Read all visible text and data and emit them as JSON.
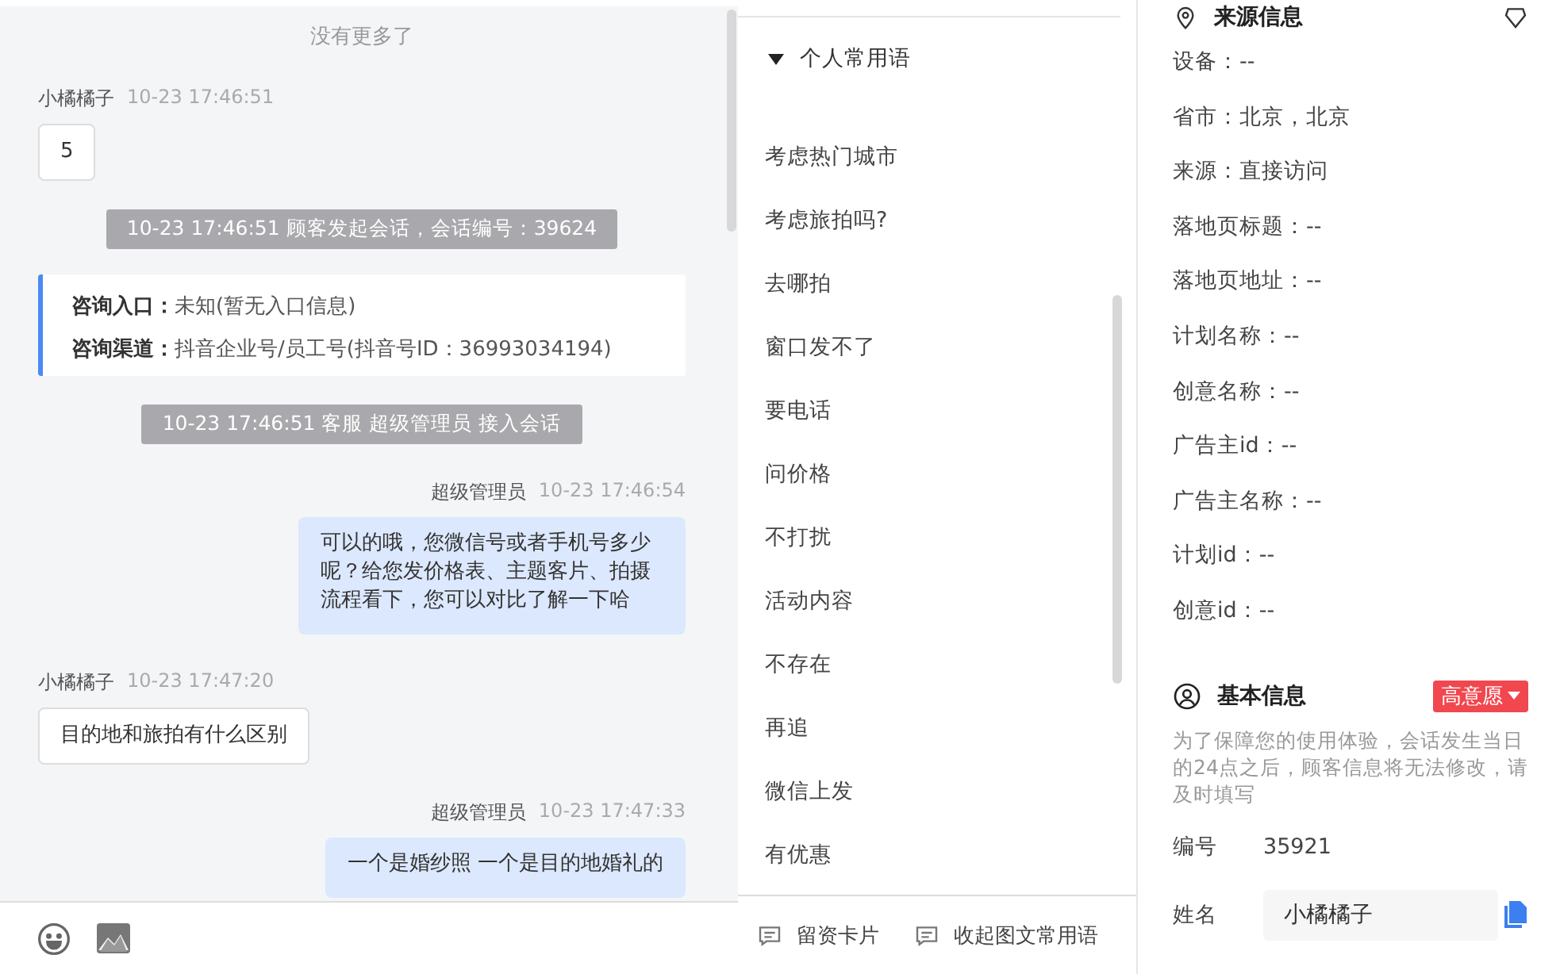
{
  "chat": {
    "messages": [
      {
        "kind": "notice",
        "text": "没有更多了"
      },
      {
        "kind": "message",
        "from_agent": false,
        "sender": "小橘橘子",
        "time": "10-23 17:46:51",
        "text": "5"
      },
      {
        "kind": "system",
        "text": "10-23 17:46:51 顾客发起会话，会话编号：39624"
      },
      {
        "kind": "info",
        "rows": [
          {
            "label": "咨询入口：",
            "value": "未知(暂无入口信息)"
          },
          {
            "label": "咨询渠道：",
            "value": "抖音企业号/员工号(抖音号ID：36993034194)"
          }
        ]
      },
      {
        "kind": "system",
        "text": "10-23 17:46:51 客服 超级管理员 接入会话"
      },
      {
        "kind": "message",
        "from_agent": true,
        "sender": "超级管理员",
        "time": "10-23 17:46:54",
        "text": "可以的哦，您微信号或者手机号多少呢？给您发价格表、主题客片、拍摄流程看下，您可以对比了解一下哈"
      },
      {
        "kind": "message",
        "from_agent": false,
        "sender": "小橘橘子",
        "time": "10-23 17:47:20",
        "text": "目的地和旅拍有什么区别"
      },
      {
        "kind": "message",
        "from_agent": true,
        "sender": "超级管理员",
        "time": "10-23 17:47:33",
        "text": "一个是婚纱照 一个是目的地婚礼的"
      }
    ]
  },
  "phrases": {
    "group": {
      "title": "个人常用语",
      "expanded": true
    },
    "items": [
      "考虑热门城市",
      "考虑旅拍吗?",
      "去哪拍",
      "窗口发不了",
      "要电话",
      "问价格",
      "不打扰",
      "活动内容",
      "不存在",
      "再追",
      "微信上发",
      "有优惠"
    ],
    "footer": [
      "留资卡片",
      "收起图文常用语"
    ]
  },
  "source_info": {
    "title": "来源信息",
    "fields": [
      "设备：--",
      "省市：北京，北京",
      "来源：直接访问",
      "落地页标题：--",
      "落地页地址：--",
      "计划名称：--",
      "创意名称：--",
      "广告主id：--",
      "广告主名称：--",
      "计划id：--",
      "创意id：--"
    ]
  },
  "basic_info": {
    "title": "基本信息",
    "intent": "高意愿",
    "hint": "为了保障您的使用体验，会话发生当日的24点之后，顾客信息将无法修改，请及时填写",
    "id_label": "编号",
    "id_value": "35921",
    "name_label": "姓名",
    "name_value": "小橘橘子"
  }
}
